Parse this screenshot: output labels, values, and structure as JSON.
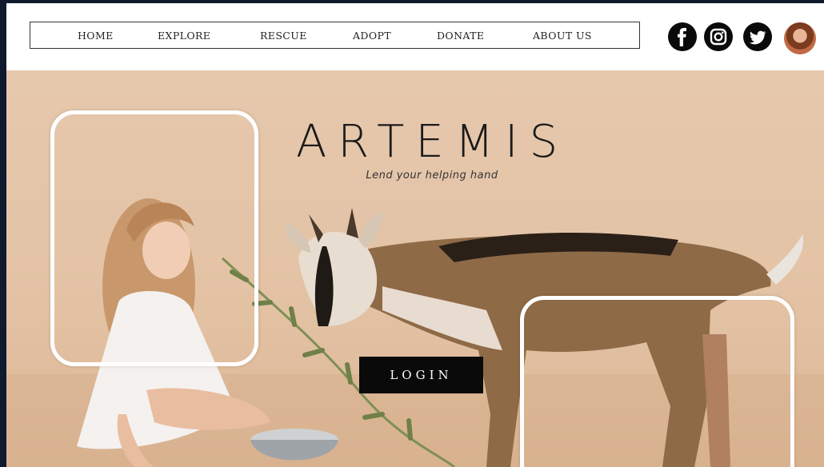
{
  "nav": {
    "items": [
      {
        "label": "HOME"
      },
      {
        "label": "EXPLORE"
      },
      {
        "label": "RESCUE"
      },
      {
        "label": "ADOPT"
      },
      {
        "label": "DONATE"
      },
      {
        "label": "ABOUT US"
      }
    ]
  },
  "social": {
    "icons": [
      "facebook-icon",
      "instagram-icon",
      "twitter-icon"
    ]
  },
  "hero": {
    "brand": "ARTEMIS",
    "tagline": "Lend your helping hand",
    "login_label": "LOGIN"
  },
  "colors": {
    "background": "#e6c8ad",
    "button": "#0a0a0a",
    "frame": "#ffffff"
  }
}
